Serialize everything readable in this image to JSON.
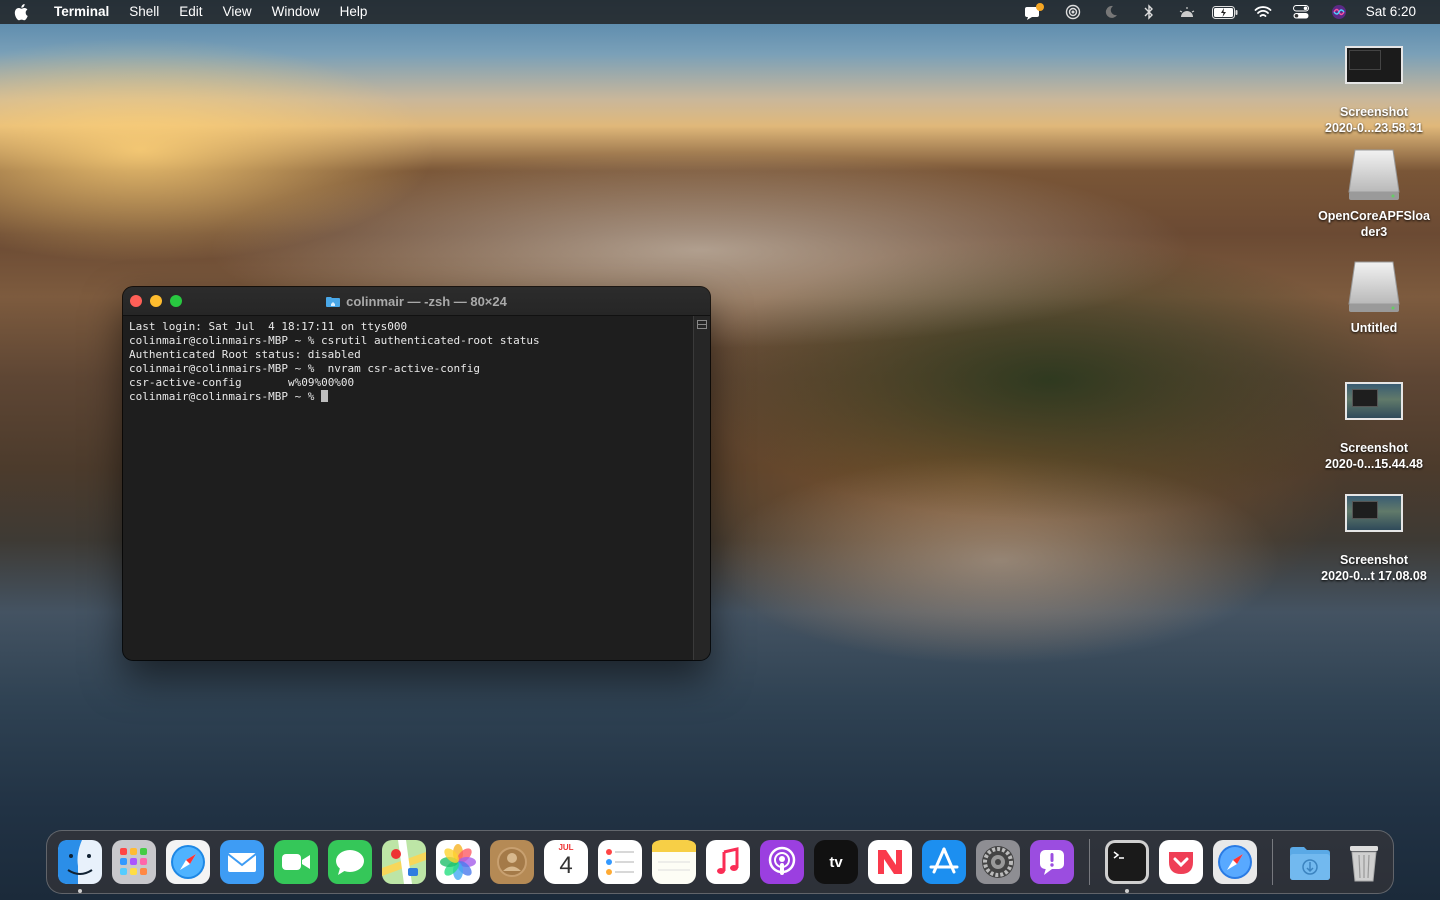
{
  "menubar": {
    "app_name": "Terminal",
    "menus": [
      "Shell",
      "Edit",
      "View",
      "Window",
      "Help"
    ],
    "clock": "Sat 6:20",
    "status_icons": [
      "notification-icon",
      "airdrop-icon",
      "focus-moon-icon",
      "bluetooth-icon",
      "brightness-icon",
      "battery-icon",
      "wifi-icon",
      "control-center-icon",
      "siri-icon"
    ]
  },
  "terminal": {
    "title": "colinmair — -zsh — 80×24",
    "lines": [
      "Last login: Sat Jul  4 18:17:11 on ttys000",
      "colinmair@colinmairs-MBP ~ % csrutil authenticated-root status",
      "Authenticated Root status: disabled",
      "colinmair@colinmairs-MBP ~ %  nvram csr-active-config",
      "csr-active-config\tw%09%00%00",
      "colinmair@colinmairs-MBP ~ % "
    ]
  },
  "desktop": {
    "icons": [
      {
        "label_1": "Screenshot",
        "label_2": "2020-0...23.58.31",
        "kind": "screenshot"
      },
      {
        "label_1": "OpenCoreAPFSloa",
        "label_2": "der3",
        "kind": "disk"
      },
      {
        "label_1": "Untitled",
        "label_2": "",
        "kind": "disk"
      },
      {
        "label_1": "Screenshot",
        "label_2": "2020-0...15.44.48",
        "kind": "screenshot"
      },
      {
        "label_1": "Screenshot",
        "label_2": "2020-0...t 17.08.08",
        "kind": "screenshot"
      }
    ]
  },
  "dock": {
    "apps": [
      "Finder",
      "Launchpad",
      "Safari",
      "Mail",
      "FaceTime",
      "Messages",
      "Maps",
      "Photos",
      "Contacts",
      "Calendar",
      "Reminders",
      "Notes",
      "Music",
      "Podcasts",
      "TV",
      "News",
      "App Store",
      "System Preferences",
      "Feedback Assistant",
      "Terminal",
      "Pocket",
      "Safari Technology Preview",
      "Downloads",
      "Trash"
    ],
    "calendar_month": "JUL",
    "calendar_day": "4",
    "tv_label": "tv"
  },
  "colors": {
    "menubar_bg": "#1e1e1e",
    "terminal_bg": "#1e1e1e",
    "close": "#fe5f57",
    "minimize": "#febc2e",
    "zoom": "#28c840"
  }
}
